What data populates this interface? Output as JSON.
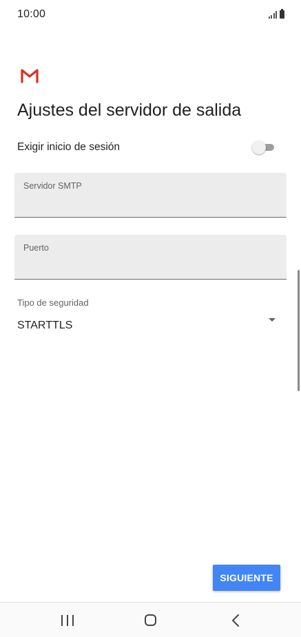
{
  "status_bar": {
    "time": "10:00",
    "signal_icon": "signal-icon",
    "battery_icon": "battery-icon"
  },
  "app": {
    "logo_icon": "gmail-icon",
    "logo_color": "#d93025"
  },
  "page": {
    "title": "Ajustes del servidor de salida"
  },
  "require_signin": {
    "label": "Exigir inicio de sesión",
    "enabled": false
  },
  "smtp_server": {
    "label": "Servidor SMTP",
    "value": ""
  },
  "port": {
    "label": "Puerto",
    "value": ""
  },
  "security_type": {
    "label": "Tipo de seguridad",
    "selected": "STARTTLS"
  },
  "actions": {
    "next_label": "SIGUIENTE",
    "accent_color": "#4285f4"
  },
  "nav_bar": {
    "recents_icon": "recents-icon",
    "home_icon": "home-icon",
    "back_icon": "back-icon"
  }
}
